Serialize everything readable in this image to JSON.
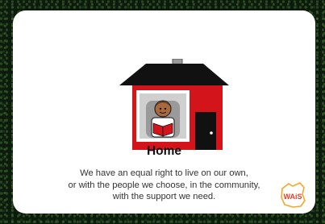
{
  "card": {
    "title": "Home",
    "description_lines": [
      "We have an equal right to live on our own,",
      "or with the people we choose, in the community,",
      "with the support we need."
    ]
  },
  "logo": {
    "text": "WAiS"
  },
  "icons": {
    "house": "house-with-person-reading-icon",
    "logo": "wais-logo-icon"
  },
  "colors": {
    "house_wall": "#d4141b",
    "roof": "#111111",
    "logo_orange": "#f5a623",
    "logo_red": "#e0402c"
  }
}
